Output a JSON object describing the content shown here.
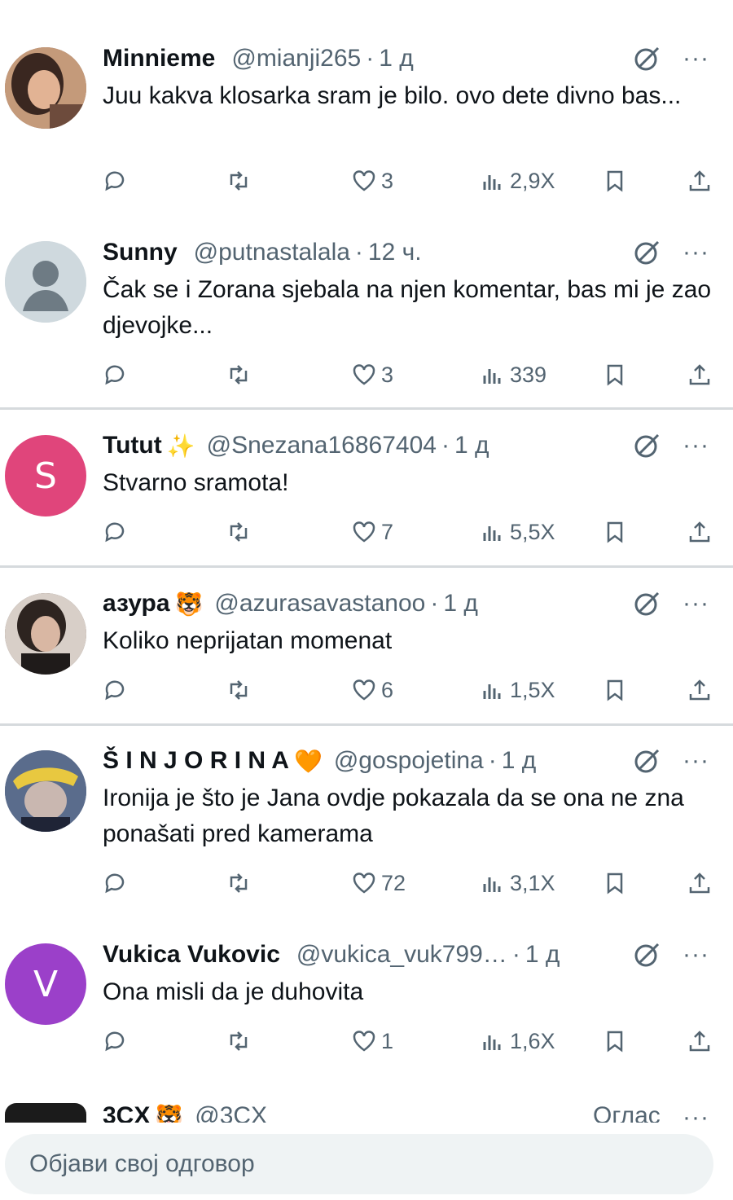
{
  "colors": {
    "text": "#0f1419",
    "muted": "#536471",
    "divider": "#d6dadd",
    "composer_bg": "#eff3f4"
  },
  "replies": [
    {
      "name": "Minnieme",
      "emoji": "",
      "handle": "@mianji265",
      "time": "1 д",
      "text": "Juu kakva klosarka sram je bilo. ovo dete divno bas...",
      "avatar": {
        "type": "photo",
        "letter": "",
        "color": "#8a5a44"
      },
      "replies": "",
      "reposts": "",
      "likes": "3",
      "views": "2,9Х"
    },
    {
      "name": "Sunny",
      "emoji": "",
      "handle": "@putnastalala",
      "time": "12 ч.",
      "text": "Čak se i Zorana sjebala na njen komentar, bas mi je zao djevojke...",
      "avatar": {
        "type": "default",
        "letter": "",
        "color": "#cfd9de"
      },
      "replies": "",
      "reposts": "",
      "likes": "3",
      "views": "339"
    },
    {
      "name": "Tutut",
      "emoji": "✨",
      "handle": "@Snezana16867404",
      "time": "1 д",
      "text": "Stvarno sramota!",
      "avatar": {
        "type": "letter",
        "letter": "S",
        "color": "#e0457b"
      },
      "replies": "",
      "reposts": "",
      "likes": "7",
      "views": "5,5Х"
    },
    {
      "name": "азура",
      "emoji": "🐯",
      "handle": "@azurasavastanoo",
      "time": "1 д",
      "text": "Koliko neprijatan momenat",
      "avatar": {
        "type": "photo",
        "letter": "",
        "color": "#6b5a52"
      },
      "replies": "",
      "reposts": "",
      "likes": "6",
      "views": "1,5Х"
    },
    {
      "name": "Š I N J O R I N A",
      "emoji": "🧡",
      "handle": "@gospojetina",
      "time": "1 д",
      "text": "Ironija je što je Jana ovdje pokazala da se ona ne zna ponašati pred kamerama",
      "avatar": {
        "type": "photo",
        "letter": "",
        "color": "#3b4a6b"
      },
      "replies": "",
      "reposts": "",
      "likes": "72",
      "views": "3,1Х"
    },
    {
      "name": "Vukica Vukovic",
      "emoji": "",
      "handle": "@vukica_vuk799…",
      "time": "1 д",
      "text": "Ona misli da je duhovita",
      "avatar": {
        "type": "letter",
        "letter": "V",
        "color": "#9b40c9"
      },
      "replies": "",
      "reposts": "",
      "likes": "1",
      "views": "1,6Х"
    }
  ],
  "partial_reply": {
    "name": "3CX",
    "emoji": "🐯",
    "handle": "@3CX",
    "badge": "Оглас"
  },
  "composer": {
    "placeholder": "Објави свој одговор"
  }
}
